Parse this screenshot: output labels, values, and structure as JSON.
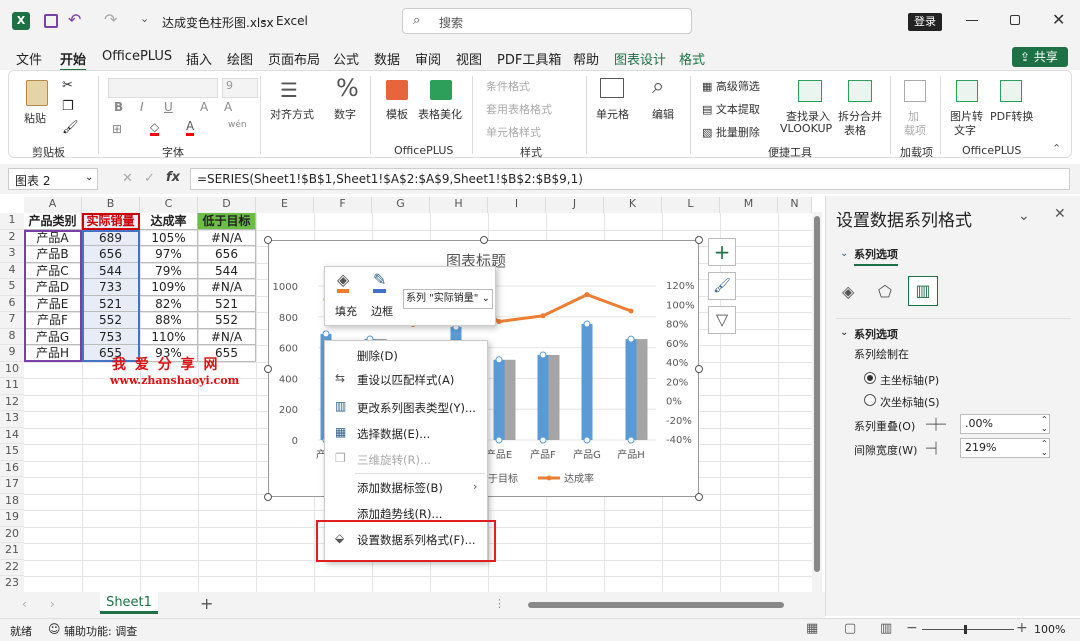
{
  "app": {
    "filename": "达成变色柱形图.xlsx",
    "app_name": "Excel",
    "search_placeholder": "搜索",
    "login_label": "登录",
    "share_label": "共享",
    "title_sep": "-"
  },
  "menu_tabs": [
    "文件",
    "开始",
    "OfficePLUS",
    "插入",
    "绘图",
    "页面布局",
    "公式",
    "数据",
    "审阅",
    "视图",
    "PDF工具箱",
    "帮助",
    "图表设计",
    "格式"
  ],
  "ribbon": {
    "paste": "粘贴",
    "clipboard": "剪贴板",
    "font_size": "9",
    "font_group": "字体",
    "bold": "B",
    "italic": "I",
    "underline": "U",
    "align": "对齐方式",
    "number": "数字",
    "template": "模板",
    "beautify": "表格美化",
    "officeplus": "OfficePLUS",
    "cond_fmt": "条件格式",
    "table_fmt": "套用表格格式",
    "cell_style": "单元格样式",
    "style_group": "样式",
    "cells": "单元格",
    "edit": "编辑",
    "adv_filter": "高级筛选",
    "text_extract": "文本提取",
    "batch_delete": "批量删除",
    "find_lookup": "查找录入",
    "vlookup": "VLOOKUP",
    "split_merge": "拆分合并",
    "table": "表格",
    "quick_tools": "便捷工具",
    "addin1": "加",
    "addin2": "载项",
    "addin_group": "加载项",
    "img_to_text1": "图片转",
    "img_to_text2": "文字",
    "pdf_convert": "PDF转换",
    "officeplus2": "OfficePLUS",
    "wen": "wén"
  },
  "formula_bar": {
    "name_box": "图表 2",
    "fx": "fx",
    "formula": "=SERIES(Sheet1!$B$1,Sheet1!$A$2:$A$9,Sheet1!$B$2:$B$9,1)"
  },
  "columns": [
    "A",
    "B",
    "C",
    "D",
    "E",
    "F",
    "G",
    "H",
    "I",
    "J",
    "K",
    "L",
    "M",
    "N"
  ],
  "rows": [
    "1",
    "2",
    "3",
    "4",
    "5",
    "6",
    "7",
    "8",
    "9",
    "10",
    "11",
    "12",
    "13",
    "14",
    "15",
    "16",
    "17",
    "18",
    "19",
    "20",
    "21",
    "22",
    "23"
  ],
  "table": {
    "headers": [
      "产品类别",
      "实际销量",
      "达成率",
      "低于目标"
    ],
    "data": [
      [
        "产品A",
        "689",
        "105%",
        "#N/A"
      ],
      [
        "产品B",
        "656",
        "97%",
        "656"
      ],
      [
        "产品C",
        "544",
        "79%",
        "544"
      ],
      [
        "产品D",
        "733",
        "109%",
        "#N/A"
      ],
      [
        "产品E",
        "521",
        "82%",
        "521"
      ],
      [
        "产品F",
        "552",
        "88%",
        "552"
      ],
      [
        "产品G",
        "753",
        "110%",
        "#N/A"
      ],
      [
        "产品H",
        "655",
        "93%",
        "655"
      ]
    ]
  },
  "watermark": {
    "title": "我 爱 分 享 网",
    "url": "www.zhanshaoyi.com"
  },
  "chart_data": {
    "type": "bar",
    "title": "图表标题",
    "categories": [
      "产品A",
      "产品B",
      "产品C",
      "产品D",
      "产品E",
      "产品F",
      "产品G",
      "产品H"
    ],
    "series": [
      {
        "name": "实际销量",
        "type": "bar",
        "values": [
          689,
          656,
          544,
          733,
          521,
          552,
          753,
          655
        ]
      },
      {
        "name": "低于目标",
        "type": "bar",
        "values": [
          null,
          656,
          544,
          null,
          521,
          552,
          null,
          655
        ]
      },
      {
        "name": "达成率",
        "type": "line",
        "axis": "secondary",
        "values": [
          1.05,
          0.97,
          0.79,
          1.09,
          0.82,
          0.88,
          1.1,
          0.93
        ]
      }
    ],
    "y_ticks": [
      "1000",
      "800",
      "600",
      "400",
      "200",
      "0"
    ],
    "y2_ticks": [
      "120%",
      "100%",
      "80%",
      "60%",
      "40%",
      "20%",
      "0%",
      "-20%",
      "-40%"
    ],
    "ylim": [
      0,
      1000
    ],
    "y2lim": [
      -0.4,
      1.2
    ],
    "legend_visible": [
      "低于目标",
      "达成率"
    ],
    "visible_x_labels": [
      "产品E",
      "产品F",
      "产品G",
      "产品H"
    ],
    "cut_x_label": "产",
    "colors": {
      "bar": "#5b9bd5",
      "bar2": "#a5a5a5",
      "line": "#ed7d31"
    }
  },
  "mini_toolbar": {
    "fill": "填充",
    "border": "边框",
    "series_select": "系列 \"实际销量\""
  },
  "context_menu": [
    "删除(D)",
    "重设以匹配样式(A)",
    "更改系列图表类型(Y)...",
    "选择数据(E)...",
    "三维旋转(R)...",
    "添加数据标签(B)",
    "添加趋势线(R)...",
    "设置数据系列格式(F)..."
  ],
  "pane": {
    "title": "设置数据系列格式",
    "tab": "系列选项",
    "section": "系列选项",
    "plot_on": "系列绘制在",
    "primary": "主坐标轴(P)",
    "secondary": "次坐标轴(S)",
    "overlap_label": "系列重叠(O)",
    "overlap_value": ".00%",
    "gap_label": "间隙宽度(W)",
    "gap_value": "219%"
  },
  "sheet_tab": "Sheet1",
  "status": {
    "ready": "就绪",
    "accessibility": "辅助功能: 调查",
    "zoom": "100%"
  }
}
